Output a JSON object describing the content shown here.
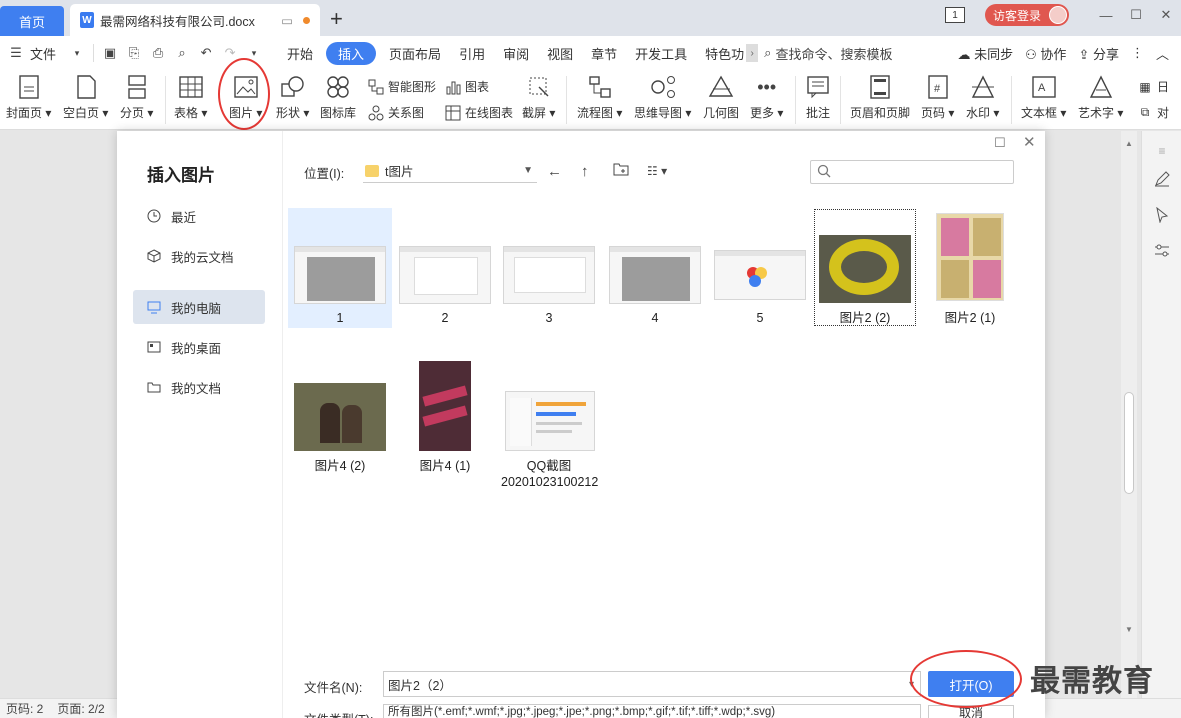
{
  "titlebar": {
    "home_tab": "首页",
    "doc_tab": "最需网络科技有限公司.docx",
    "doc_icon": "W",
    "add_tab": "+",
    "badge": "1",
    "login": "访客登录",
    "win_min": "—",
    "win_max": "☐",
    "win_close": "✕"
  },
  "menu": {
    "file": "文件",
    "items": [
      "开始",
      "插入",
      "页面布局",
      "引用",
      "审阅",
      "视图",
      "章节",
      "开发工具",
      "特色功"
    ],
    "search": "查找命令、搜索模板",
    "sync": "未同步",
    "collab": "协作",
    "share": "分享"
  },
  "ribbon": {
    "cover": "封面页",
    "blank": "空白页",
    "pagebreak": "分页",
    "table": "表格",
    "picture": "图片",
    "shape": "形状",
    "iconlib": "图标库",
    "smartart": "智能图形",
    "relation": "关系图",
    "chart": "图表",
    "onlinechart": "在线图表",
    "screenshot": "截屏",
    "flowchart": "流程图",
    "mindmap": "思维导图",
    "geometry": "几何图",
    "more": "更多",
    "comment": "批注",
    "headerfooter": "页眉和页脚",
    "pagenum": "页码",
    "watermark": "水印",
    "textbox": "文本框",
    "wordart": "艺术字",
    "date": "日",
    "obj": "对"
  },
  "dialog": {
    "title": "插入图片",
    "sidebar": [
      "最近",
      "我的云文档",
      "我的电脑",
      "我的桌面",
      "我的文档"
    ],
    "location_label": "位置(I):",
    "location_value": "t图片",
    "search_placeholder": "",
    "files": [
      "1",
      "2",
      "3",
      "4",
      "5",
      "图片2 (2)",
      "图片2 (1)",
      "图片4 (2)",
      "图片4 (1)",
      "QQ截图",
      "20201023100212"
    ],
    "filename_label": "文件名(N):",
    "filename_value": "图片2（2）",
    "filetype_label": "文件类型(T):",
    "filetype_value": "所有图片(*.emf;*.wmf;*.jpg;*.jpeg;*.jpe;*.png;*.bmp;*.gif;*.tif;*.tiff;*.wdp;*.svg)",
    "open": "打开(O)",
    "cancel": "取消"
  },
  "status": {
    "page": "页码: 2",
    "pages": "页面: 2/2"
  },
  "watermark_text": "最需教育",
  "colors": {
    "accent": "#3f7ff0",
    "login": "#e0574f",
    "annotation": "#e53935"
  }
}
